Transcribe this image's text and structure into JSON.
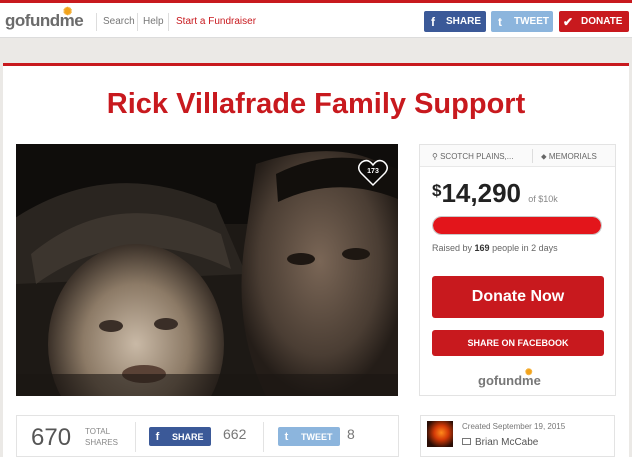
{
  "header": {
    "logo": {
      "go": "go",
      "fund": "fund",
      "me": "me"
    },
    "nav": {
      "search": "Search",
      "help": "Help",
      "start": "Start a Fundraiser"
    },
    "buttons": {
      "share": "SHARE",
      "tweet": "TWEET",
      "donate": "DONATE"
    }
  },
  "campaign": {
    "title": "Rick Villafrade Family Support",
    "hearts": "173",
    "location": "SCOTCH PLAINS,...",
    "category": "MEMORIALS",
    "amount_symbol": "$",
    "amount": "14,290",
    "goal": "of $10k",
    "progress": 1.0,
    "raised_prefix": "Raised by",
    "people": "169",
    "raised_middle": "people in",
    "duration": "2 days",
    "donate_label": "Donate Now",
    "share_fb_label": "SHARE ON FACEBOOK",
    "side_logo": "gofundme"
  },
  "stats": {
    "total": "670",
    "total_label": "TOTAL SHARES",
    "share_label": "SHARE",
    "share_count": "662",
    "tweet_label": "TWEET",
    "tweet_count": "8"
  },
  "creator": {
    "created": "Created September 19, 2015",
    "name": "Brian McCabe"
  },
  "colors": {
    "brand_red": "#c8191e",
    "facebook": "#3b5998",
    "twitter": "#8cb5dd",
    "logo_sun": "#f2a31b"
  }
}
